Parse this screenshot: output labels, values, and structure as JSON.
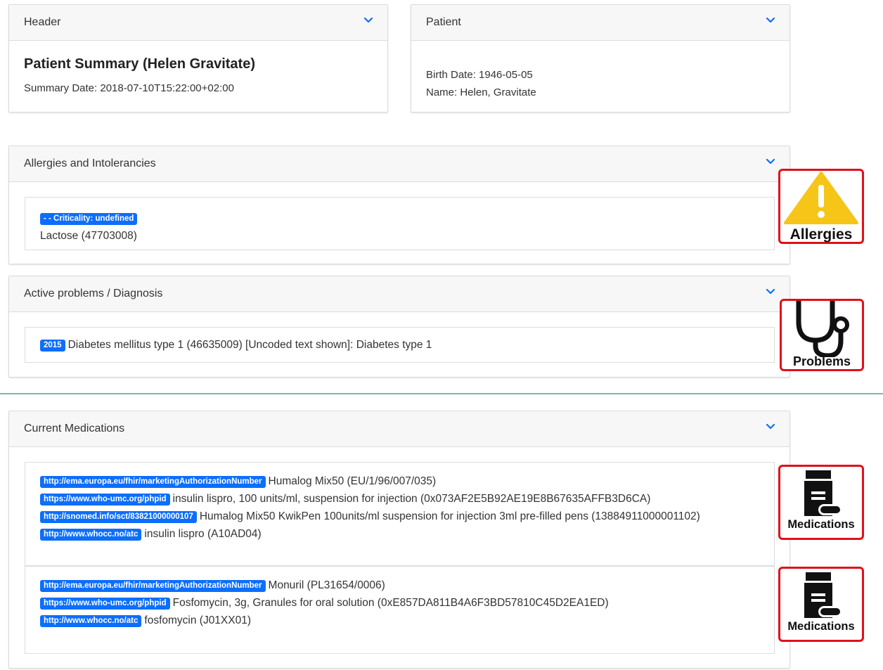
{
  "header_card": {
    "title": "Header",
    "summary_title": "Patient Summary (Helen Gravitate)",
    "summary_date": "Summary Date: 2018-07-10T15:22:00+02:00"
  },
  "patient_card": {
    "title": "Patient",
    "birth_date": "Birth Date: 1946-05-05",
    "name": "Name: Helen, Gravitate"
  },
  "allergies": {
    "title": "Allergies and Intolerancies",
    "badge": "- - Criticality: undefined",
    "text": "Lactose (47703008)",
    "icon_label": "Allergies"
  },
  "problems": {
    "title": "Active problems / Diagnosis",
    "badge": "2015",
    "text": "Diabetes mellitus type 1 (46635009) [Uncoded text shown]: Diabetes type 1",
    "icon_label": "Problems"
  },
  "medications": {
    "title": "Current Medications",
    "icon_label": "Medications",
    "entries": [
      {
        "lines": [
          {
            "badge": "http://ema.europa.eu/fhir/marketingAuthorizationNumber",
            "text": "Humalog Mix50 (EU/1/96/007/035)"
          },
          {
            "badge": "https://www.who-umc.org/phpid",
            "text": "insulin lispro, 100 units/ml, suspension for injection (0x073AF2E5B92AE19E8B67635AFFB3D6CA)"
          },
          {
            "badge": "http://snomed.info/sct/83821000000107",
            "text": "Humalog Mix50 KwikPen 100units/ml suspension for injection 3ml pre-filled pens (13884911000001102)"
          },
          {
            "badge": "http://www.whocc.no/atc",
            "text": "insulin lispro (A10AD04)"
          }
        ]
      },
      {
        "lines": [
          {
            "badge": "http://ema.europa.eu/fhir/marketingAuthorizationNumber",
            "text": "Monuril (PL31654/0006)"
          },
          {
            "badge": "https://www.who-umc.org/phpid",
            "text": "Fosfomycin, 3g, Granules for oral solution (0xE857DA811B4A6F3BD57810C45D2EA1ED)"
          },
          {
            "badge": "http://www.whocc.no/atc",
            "text": "fosfomycin (J01XX01)"
          }
        ]
      }
    ]
  },
  "colors": {
    "badge_blue": "#0d6efd",
    "chevron_blue": "#0d6efd",
    "icon_border_red": "#e0101a",
    "warning_yellow": "#f5c518",
    "separator_green": "#6cc3a4"
  }
}
